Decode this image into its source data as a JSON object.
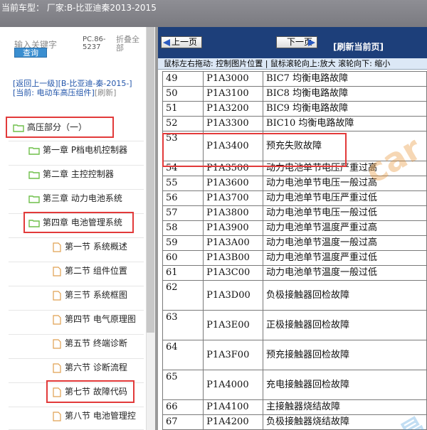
{
  "header": {
    "title": "当前车型： 厂家:B-比亚迪秦2013-2015"
  },
  "left": {
    "keyword_label": "输入关键字",
    "search_button": "查询",
    "pc_text": "PC.86-5237",
    "fold_label": "折叠全部",
    "nav": {
      "back": "[返回上一级]",
      "vehicle": "[B-比亚迪-秦-2015-]",
      "current": "[当前: 电动车高压组件]",
      "refresh": "[刷新]"
    },
    "tree": [
      {
        "label": "高压部分（一）",
        "type": "folder"
      },
      {
        "label": "第一章 P档电机控制器",
        "type": "folder"
      },
      {
        "label": "第二章 主控控制器",
        "type": "folder"
      },
      {
        "label": "第三章 动力电池系统",
        "type": "folder"
      },
      {
        "label": "第四章 电池管理系统",
        "type": "folder"
      },
      {
        "label": "第一节 系统概述",
        "type": "page"
      },
      {
        "label": "第二节 组件位置",
        "type": "page"
      },
      {
        "label": "第三节 系统框图",
        "type": "page"
      },
      {
        "label": "第四节 电气原理图",
        "type": "page"
      },
      {
        "label": "第五节 终端诊断",
        "type": "page"
      },
      {
        "label": "第六节 诊断流程",
        "type": "page"
      },
      {
        "label": "第七节 故障代码",
        "type": "page"
      },
      {
        "label": "第八节 电池管理控",
        "type": "page"
      }
    ]
  },
  "toolbar": {
    "prev": "上一页",
    "next": "下一页",
    "refresh": "[刷新当前页]",
    "hint": "鼠标左右拖动: 控制图片位置 | 鼠标滚轮向上:放大  滚轮向下: 缩小"
  },
  "table": {
    "rows": [
      {
        "no": "49",
        "code": "P1A3000",
        "desc": "BIC7 均衡电路故障",
        "tall": false
      },
      {
        "no": "50",
        "code": "P1A3100",
        "desc": "BIC8 均衡电路故障",
        "tall": false
      },
      {
        "no": "51",
        "code": "P1A3200",
        "desc": "BIC9 均衡电路故障",
        "tall": false
      },
      {
        "no": "52",
        "code": "P1A3300",
        "desc": "BIC10 均衡电路故障",
        "tall": false
      },
      {
        "no": "53",
        "code": "P1A3400",
        "desc": "预充失败故障",
        "tall": true
      },
      {
        "no": "54",
        "code": "P1A3500",
        "desc": "动力电池单节电压严重过高",
        "tall": false
      },
      {
        "no": "55",
        "code": "P1A3600",
        "desc": "动力电池单节电压一般过高",
        "tall": false
      },
      {
        "no": "56",
        "code": "P1A3700",
        "desc": "动力电池单节电压严重过低",
        "tall": false
      },
      {
        "no": "57",
        "code": "P1A3800",
        "desc": "动力电池单节电压一般过低",
        "tall": false
      },
      {
        "no": "58",
        "code": "P1A3900",
        "desc": "动力电池单节温度严重过高",
        "tall": false
      },
      {
        "no": "59",
        "code": "P1A3A00",
        "desc": "动力电池单节温度一般过高",
        "tall": false
      },
      {
        "no": "60",
        "code": "P1A3B00",
        "desc": "动力电池单节温度严重过低",
        "tall": false
      },
      {
        "no": "61",
        "code": "P1A3C00",
        "desc": "动力电池单节温度一般过低",
        "tall": false
      },
      {
        "no": "62",
        "code": "P1A3D00",
        "desc": "负极接触器回检故障",
        "tall": true
      },
      {
        "no": "63",
        "code": "P1A3E00",
        "desc": "正极接触器回检故障",
        "tall": true
      },
      {
        "no": "64",
        "code": "P1A3F00",
        "desc": "预充接触器回检故障",
        "tall": true
      },
      {
        "no": "65",
        "code": "P1A4000",
        "desc": "充电接触器回检故障",
        "tall": true
      },
      {
        "no": "66",
        "code": "P1A4100",
        "desc": "主接触器烧结故障",
        "tall": false
      },
      {
        "no": "67",
        "code": "P1A4200",
        "desc": "负极接触器烧结故障",
        "tall": false
      }
    ]
  },
  "colors": {
    "highlight": "#e23a3a",
    "toolbar_bg": "#1d3f7a",
    "folder": "#6fbf4a"
  }
}
